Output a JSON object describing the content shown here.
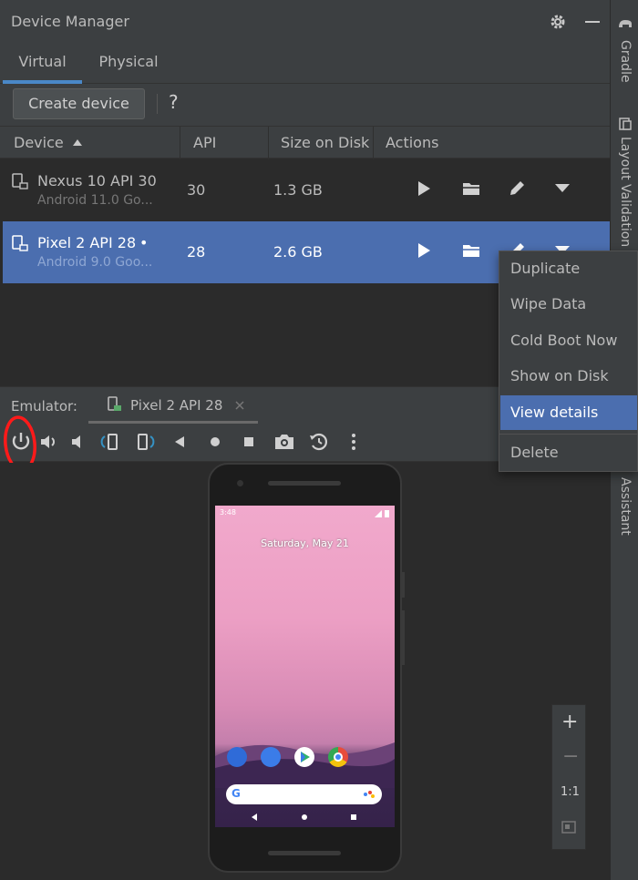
{
  "window": {
    "title": "Device Manager"
  },
  "tabs": [
    {
      "label": "Virtual",
      "active": true
    },
    {
      "label": "Physical",
      "active": false
    }
  ],
  "toolbar": {
    "create_device_label": "Create device",
    "help_label": "?"
  },
  "table": {
    "headers": {
      "device": "Device",
      "api": "API",
      "size": "Size on Disk",
      "actions": "Actions"
    },
    "sort_column": "Device",
    "rows": [
      {
        "name": "Nexus 10 API 30",
        "subtitle": "Android 11.0 Go...",
        "api": "30",
        "size": "1.3 GB",
        "selected": false,
        "running": false
      },
      {
        "name": "Pixel 2 API 28",
        "subtitle": "Android 9.0 Goo...",
        "api": "28",
        "size": "2.6 GB",
        "selected": true,
        "running": true,
        "running_indicator": "•"
      }
    ]
  },
  "context_menu": {
    "items": [
      {
        "label": "Duplicate"
      },
      {
        "label": "Wipe Data"
      },
      {
        "label": "Cold Boot Now"
      },
      {
        "label": "Show on Disk"
      },
      {
        "label": "View details",
        "highlighted": true
      },
      {
        "label": "Delete"
      }
    ]
  },
  "emulator": {
    "label": "Emulator:",
    "tab_title": "Pixel 2 API 28",
    "toolbar_icons": [
      "power-icon",
      "volume-up-icon",
      "volume-down-icon",
      "rotate-left-icon",
      "rotate-right-icon",
      "back-icon",
      "home-icon",
      "overview-icon",
      "screenshot-icon",
      "snapshot-icon",
      "more-icon"
    ]
  },
  "phone_screen": {
    "date": "Saturday, May 21",
    "status_time": "3:48",
    "dock_apps": [
      "phone",
      "messages",
      "play-store",
      "chrome"
    ]
  },
  "zoom": {
    "zoom_in": "+",
    "zoom_out": "−",
    "actual_size": "1:1"
  },
  "right_strip": {
    "tabs": [
      "Gradle",
      "Layout Validation",
      "Assistant"
    ]
  },
  "colors": {
    "panel": "#3c3f41",
    "background": "#2b2b2b",
    "selection": "#4b6eaf",
    "accent_tab": "#4a88c7",
    "annotation": "#ff0000"
  }
}
